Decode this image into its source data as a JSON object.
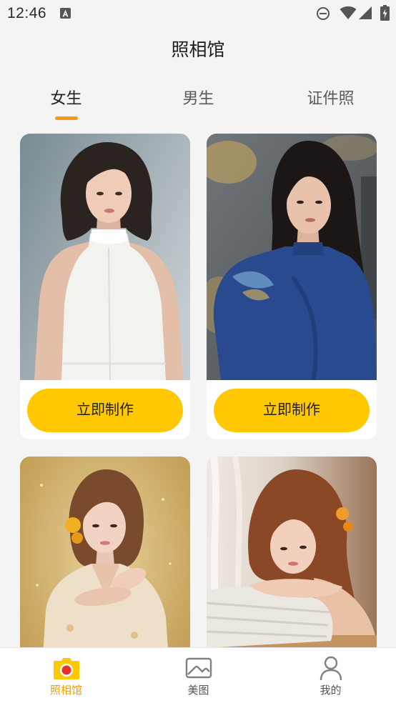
{
  "status_bar": {
    "time": "12:46",
    "icons": [
      "a-notification-icon",
      "do-not-disturb-icon",
      "wifi-icon",
      "signal-icon",
      "battery-charging-icon"
    ]
  },
  "header": {
    "title": "照相馆"
  },
  "tabs": [
    {
      "label": "女生",
      "active": true
    },
    {
      "label": "男生",
      "active": false
    },
    {
      "label": "证件照",
      "active": false
    }
  ],
  "cards": [
    {
      "button_label": "立即制作"
    },
    {
      "button_label": "立即制作"
    },
    {},
    {}
  ],
  "bottom_nav": {
    "items": [
      {
        "label": "照相馆",
        "icon": "camera-icon",
        "active": true
      },
      {
        "label": "美图",
        "icon": "image-icon",
        "active": false
      },
      {
        "label": "我的",
        "icon": "person-icon",
        "active": false
      }
    ]
  },
  "colors": {
    "background": "#f4f4f4",
    "accent": "#FFC800",
    "tab_indicator": "#F59A12",
    "nav_active": "#E9A300"
  }
}
